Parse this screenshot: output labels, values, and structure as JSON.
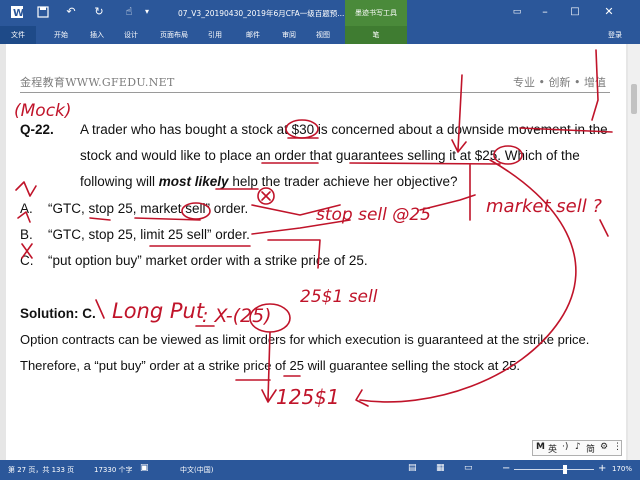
{
  "titlebar": {
    "document_title": "07_V3_20190430_2019年6月CFA一级百题预...",
    "tools_title": "墨迹书写工具",
    "save_icon": "save-icon",
    "undo_icon": "undo-icon",
    "redo_icon": "redo-icon",
    "touch_icon": "touch-mode-icon"
  },
  "ribbon": {
    "tabs": [
      "文件",
      "开始",
      "插入",
      "设计",
      "页面布局",
      "引用",
      "邮件",
      "审阅",
      "视图",
      "笔"
    ],
    "signin": "登录"
  },
  "document": {
    "header_left": "金程教育WWW.GFEDU.NET",
    "header_right": "专业 • 创新 • 增值",
    "question_number": "Q-22.",
    "question_lines": [
      "A trader who has bought a stock at $30 is concerned about a downside movement in the",
      "stock and would like to place an order that guarantees selling it at $25. Which of the",
      "following will most likely help the trader achieve her objective?"
    ],
    "question_line3_parts": [
      "following will ",
      "most likely",
      " help the trader achieve her objective?"
    ],
    "options": [
      {
        "letter": "A.",
        "text": "“GTC, stop 25, market sell” order."
      },
      {
        "letter": "B.",
        "text": "“GTC, stop 25, limit 25 sell” order."
      },
      {
        "letter": "C.",
        "text": "“put option buy” market order with a strike price of 25."
      }
    ],
    "solution_label": "Solution: C.",
    "solution_lines": [
      "Option contracts can be viewed as limit orders for which execution is guaranteed at the strike price.",
      "Therefore, a “put buy” order at a strike price of 25 will guarantee selling the stock at 25."
    ]
  },
  "ink": {
    "color": "#c0142a",
    "notes": [
      "(Mock)",
      "stop sell @25",
      "market sell ?",
      "Long Put",
      ": X-(25)",
      "25$1 sell",
      "125$1"
    ]
  },
  "ime": {
    "items": [
      "M",
      "英",
      "·)",
      "♪",
      "简",
      "⚙",
      "⋮"
    ]
  },
  "statusbar": {
    "page": "第 27 页，共 133 页",
    "words": "17330 个字",
    "proofing_icon": "proofing-icon",
    "language": "中文(中国)",
    "zoom_minus": "−",
    "zoom_plus": "+",
    "zoom": "170%"
  }
}
